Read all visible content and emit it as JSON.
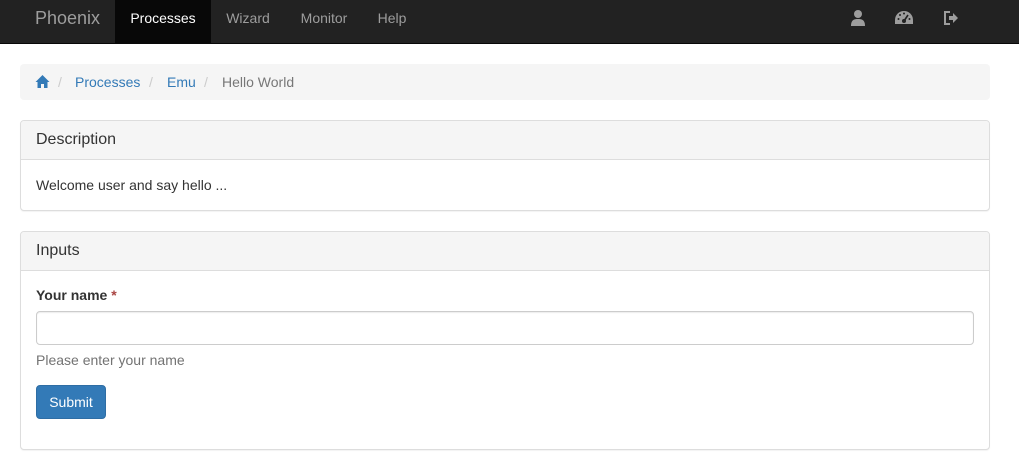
{
  "navbar": {
    "brand": "Phoenix",
    "items": [
      {
        "label": "Processes",
        "active": true
      },
      {
        "label": "Wizard",
        "active": false
      },
      {
        "label": "Monitor",
        "active": false
      },
      {
        "label": "Help",
        "active": false
      }
    ],
    "right_icons": [
      "user-icon",
      "dashboard-icon",
      "logout-icon"
    ]
  },
  "breadcrumb": {
    "home_icon": "home-icon",
    "separator": "/",
    "items": [
      {
        "label": "Processes",
        "link": true
      },
      {
        "label": "Emu",
        "link": true
      },
      {
        "label": "Hello World",
        "link": false
      }
    ]
  },
  "description_panel": {
    "title": "Description",
    "text": "Welcome user and say hello ..."
  },
  "inputs_panel": {
    "title": "Inputs",
    "field": {
      "label": "Your name",
      "required_marker": "*",
      "value": "",
      "help": "Please enter your name"
    },
    "submit_label": "Submit"
  },
  "colors": {
    "navbar_bg": "#222222",
    "active_nav_bg": "#080808",
    "link": "#337ab7",
    "primary_button": "#337ab7",
    "required": "#a94442"
  }
}
